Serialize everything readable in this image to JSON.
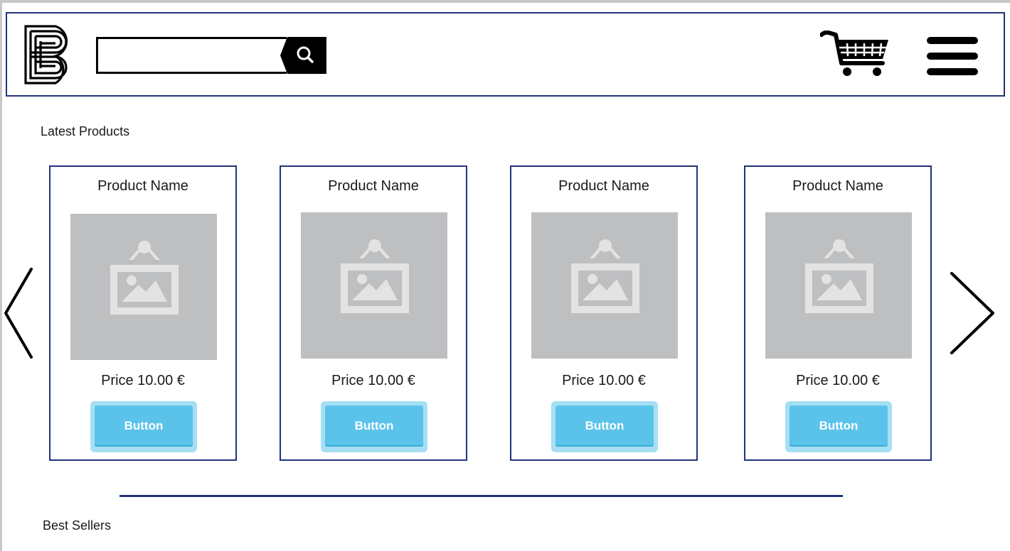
{
  "header": {
    "logo_icon": "letter-b-logo-icon",
    "search": {
      "value": "",
      "placeholder": ""
    },
    "search_icon": "search-icon",
    "cart_icon": "shopping-cart-icon",
    "menu_icon": "hamburger-menu-icon"
  },
  "latest": {
    "title": "Latest Products",
    "products": [
      {
        "name": "Product Name",
        "price": "Price 10.00 €",
        "button": "Button"
      },
      {
        "name": "Product Name",
        "price": "Price 10.00 €",
        "button": "Button"
      },
      {
        "name": "Product Name",
        "price": "Price 10.00 €",
        "button": "Button"
      },
      {
        "name": "Product Name",
        "price": "Price 10.00 €",
        "button": "Button"
      }
    ]
  },
  "best": {
    "title": "Best Sellers"
  },
  "colors": {
    "border": "#22337a",
    "button": "#5bc3ea",
    "button_glow": "#a6dff4",
    "image_placeholder": "#bebfc1"
  }
}
